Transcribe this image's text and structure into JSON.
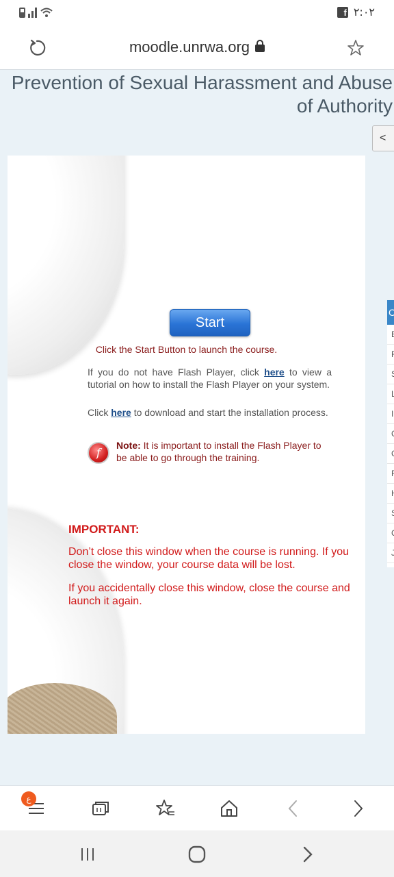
{
  "status_bar": {
    "time": "٢:٠٢"
  },
  "browser": {
    "url": "moodle.unrwa.org"
  },
  "page": {
    "title": "Prevention of Sexual Harassment and Abuse of Authority",
    "collapse_label": "<",
    "side_panel": {
      "header": "C",
      "items": [
        "E",
        "F",
        "S",
        "L",
        "I",
        "C",
        "C",
        "F",
        "H",
        "S",
        "C",
        "J"
      ]
    }
  },
  "course": {
    "start_label": "Start",
    "start_caption": "Click the Start Button to launch the course.",
    "info1_before": "If you do not have Flash Player, click ",
    "info1_link": "here",
    "info1_after": " to view a tutorial on how to install the Flash Player on your system.",
    "info2_before": "Click ",
    "info2_link": "here",
    "info2_after": " to download and start the installation process.",
    "note_label": "Note:",
    "note_text": " It is important to install the Flash Player to be able to go through the training.",
    "important_heading": "IMPORTANT:",
    "important_1": "Don’t close this window when the course is running. If you close the window, your course data will be lost.",
    "important_2": "If you accidentally close this window, close the course and launch it again."
  },
  "toolbar": {
    "badge": "ع"
  },
  "colors": {
    "accent_blue": "#2a74d6",
    "warning_red": "#d11a1a",
    "caption_dark_red": "#8a1c1c",
    "page_bg": "#eaf2f7"
  }
}
